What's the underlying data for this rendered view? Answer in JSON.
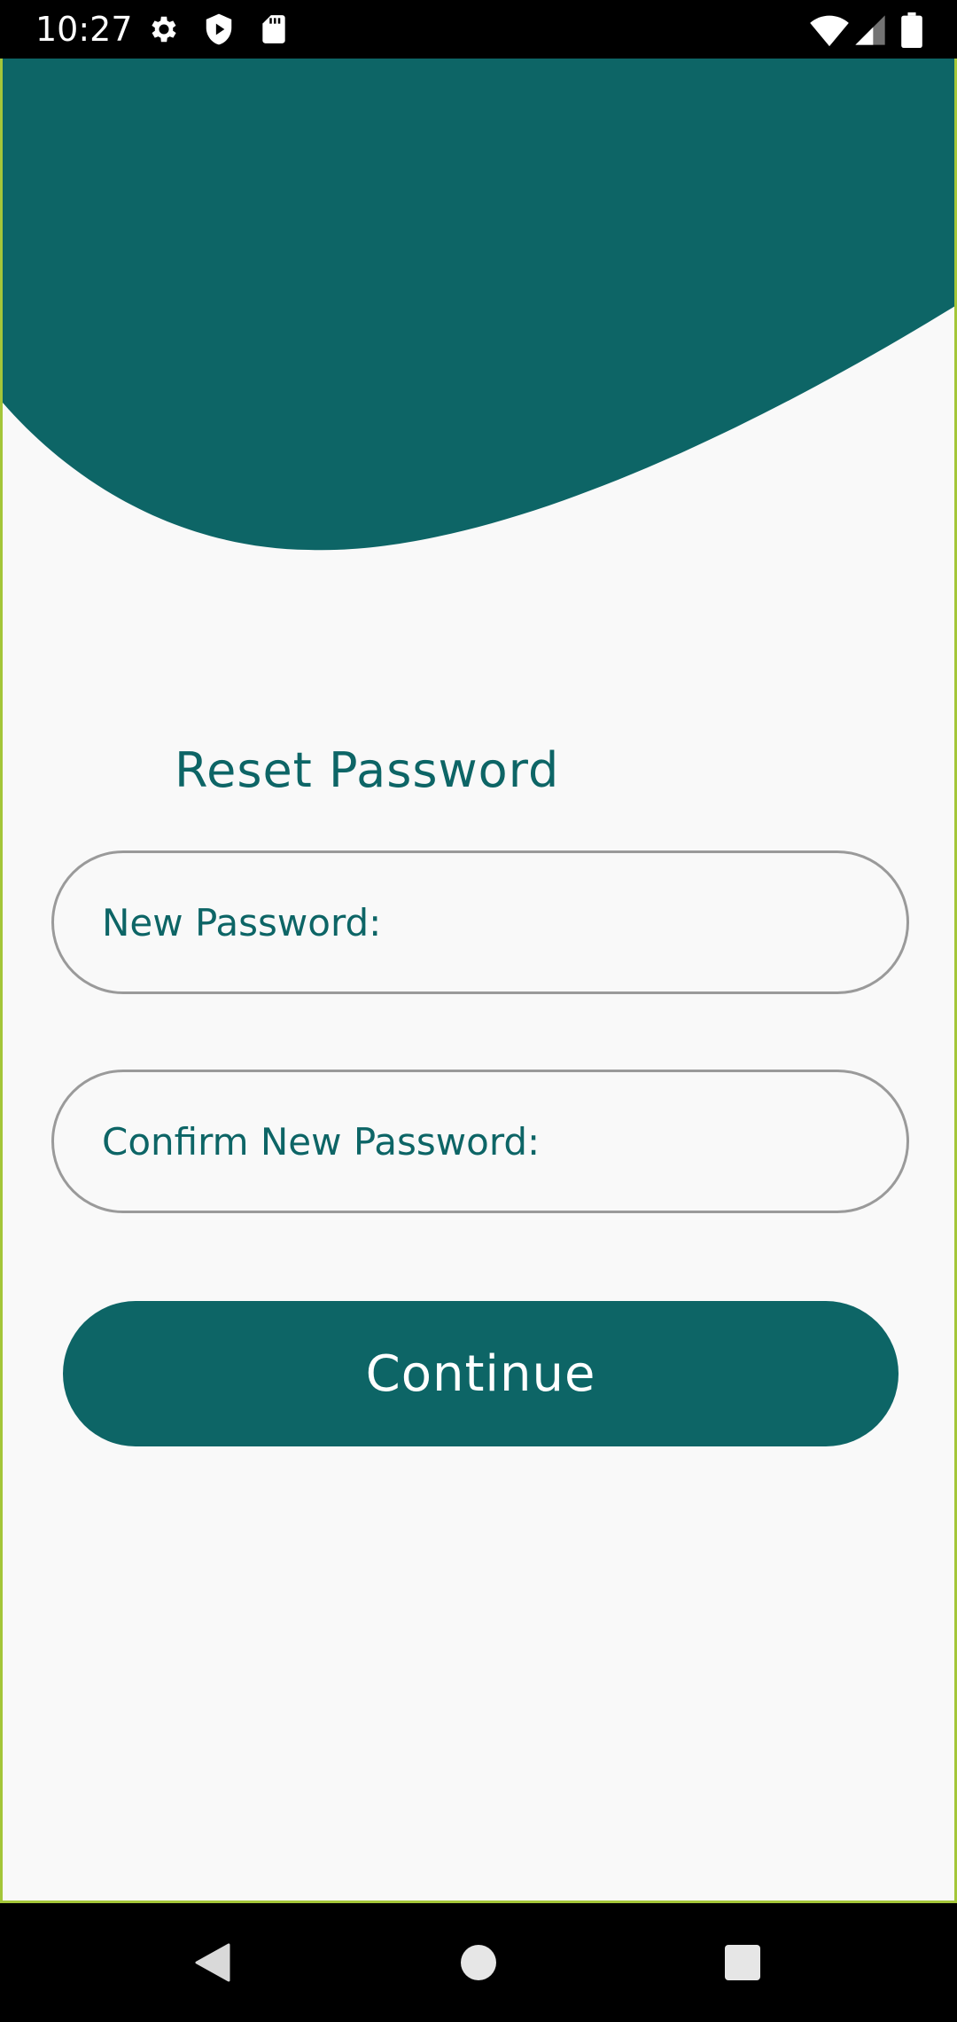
{
  "status_bar": {
    "time": "10:27",
    "icons_left": [
      "settings-icon",
      "shield-play-icon",
      "sd-card-icon"
    ],
    "icons_right": [
      "wifi-icon",
      "cell-signal-icon",
      "battery-icon"
    ]
  },
  "screen": {
    "title": "Reset Password",
    "new_password_label": "New Password:",
    "new_password_value": "",
    "confirm_password_label": "Confirm New Password:",
    "confirm_password_value": "",
    "continue_label": "Continue"
  },
  "nav_bar": {
    "buttons": [
      "back-icon",
      "home-icon",
      "recents-icon"
    ]
  },
  "colors": {
    "primary": "#0d6566",
    "background": "#f9f9f9",
    "field_border": "#9a9a9a",
    "frame_border": "#a4c639"
  }
}
